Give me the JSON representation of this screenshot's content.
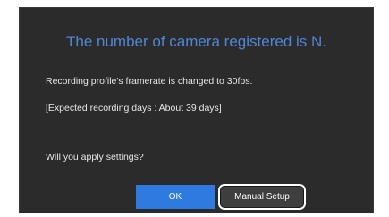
{
  "dialog": {
    "title": "The number of camera registered is N.",
    "message_line1": "Recording profile's framerate is changed to 30fps.",
    "message_line2": "[Expected recording days : About 39 days]",
    "question": "Will you apply settings?",
    "ok_label": "OK",
    "manual_setup_label": "Manual Setup"
  },
  "colors": {
    "dialog_background": "#2b2b2b",
    "title": "#4f86d6",
    "ok_button": "#2f7ae0",
    "manual_button": "#3e3e3e"
  }
}
